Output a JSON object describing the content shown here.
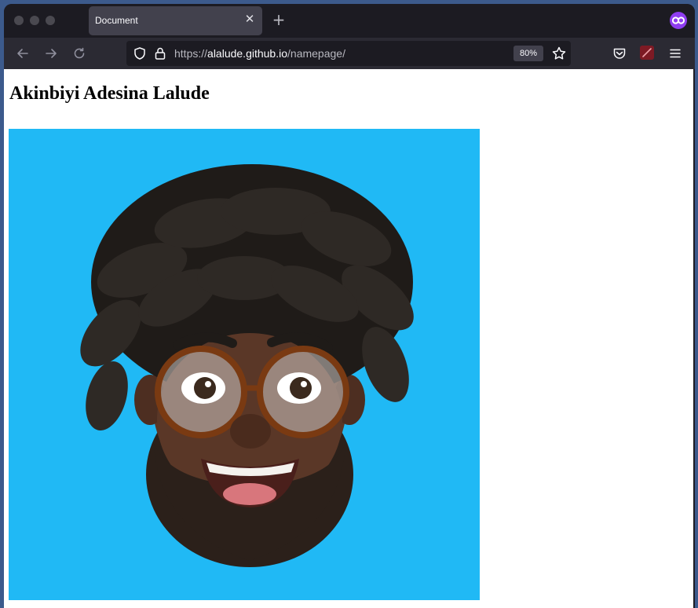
{
  "browser": {
    "tab": {
      "title": "Document",
      "close_glyph": "✕"
    },
    "new_tab_glyph": "+",
    "address_bar": {
      "scheme": "https://",
      "host": "alalude.github.io",
      "path": "/namepage/",
      "zoom": "80%"
    },
    "icons": [
      "back-arrow-icon",
      "forward-arrow-icon",
      "reload-icon",
      "shield-icon",
      "lock-icon",
      "bookmark-star-icon",
      "pocket-icon",
      "extension-icon",
      "menu-icon",
      "private-browsing-icon"
    ],
    "colors": {
      "chrome": "#1c1b22",
      "toolbar": "#2b2a33",
      "tab": "#42414d",
      "private": "#8f3df0"
    }
  },
  "page": {
    "heading": "Akinbiyi Adesina Lalude",
    "image": {
      "description_alt": "Memoji avatar",
      "background": "#20b9f5"
    }
  }
}
